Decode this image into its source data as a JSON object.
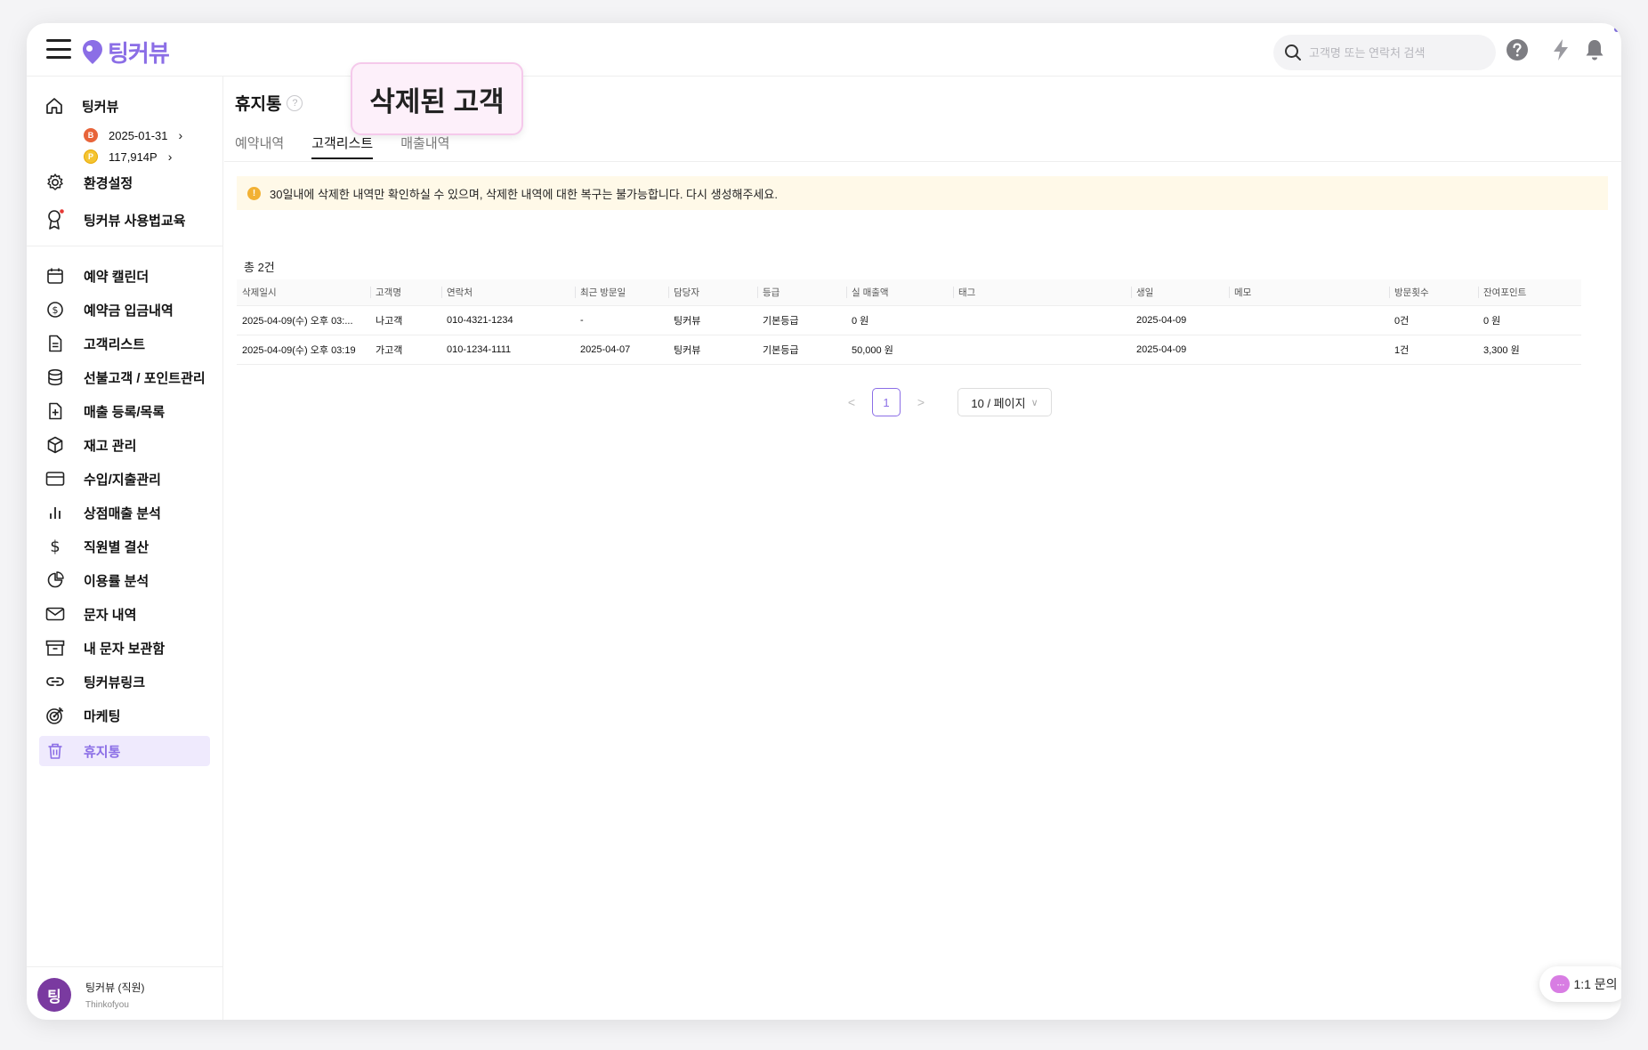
{
  "app": {
    "logo_text": "팅커뷰",
    "search_placeholder": "고객명 또는 연락처 검색"
  },
  "sidebar": {
    "home_title": "팅커뷰",
    "expire_date": "2025-01-31",
    "points": "117,914P",
    "settings": "환경설정",
    "education": "팅커뷰 사용법교육",
    "items": [
      {
        "label": "예약 캘린더"
      },
      {
        "label": "예약금 입금내역"
      },
      {
        "label": "고객리스트"
      },
      {
        "label": "선불고객 / 포인트관리"
      },
      {
        "label": "매출 등록/목록"
      },
      {
        "label": "재고 관리"
      },
      {
        "label": "수입/지출관리"
      },
      {
        "label": "상점매출 분석"
      },
      {
        "label": "직원별 결산"
      },
      {
        "label": "이용률 분석"
      },
      {
        "label": "문자 내역"
      },
      {
        "label": "내 문자 보관함"
      },
      {
        "label": "팅커뷰링크"
      },
      {
        "label": "마케팅"
      },
      {
        "label": "휴지통"
      }
    ],
    "user": {
      "avatar": "팅",
      "name": "팅커뷰 (직원)",
      "sub": "Thinkofyou"
    }
  },
  "main": {
    "title": "휴지통",
    "help": "?",
    "bubble": "삭제된 고객",
    "tabs": [
      {
        "label": "예약내역"
      },
      {
        "label": "고객리스트"
      },
      {
        "label": "매출내역"
      }
    ],
    "alert_icon": "!",
    "alert": "30일내에 삭제한 내역만 확인하실 수 있으며, 삭제한 내역에 대한 복구는 불가능합니다. 다시 생성해주세요.",
    "total": "총 2건",
    "table": {
      "headers": [
        "삭제일시",
        "고객명",
        "연락처",
        "최근 방문일",
        "담당자",
        "등급",
        "실 매출액",
        "태그",
        "생일",
        "메모",
        "방문횟수",
        "잔여포인트"
      ],
      "rows": [
        [
          "2025-04-09(수) 오후 03:...",
          "나고객",
          "010-4321-1234",
          "-",
          "팅커뷰",
          "기본등급",
          "0 원",
          "",
          "2025-04-09",
          "",
          "0건",
          "0 원"
        ],
        [
          "2025-04-09(수) 오후 03:19",
          "가고객",
          "010-1234-1111",
          "2025-04-07",
          "팅커뷰",
          "기본등급",
          "50,000 원",
          "",
          "2025-04-09",
          "",
          "1건",
          "3,300 원"
        ]
      ]
    },
    "pager": {
      "prev": "<",
      "page": "1",
      "next": ">",
      "size": "10 / 페이지",
      "size_chevron": "∨"
    }
  },
  "inquiry": {
    "icon": "···",
    "label": "1:1 문의"
  },
  "colors": {
    "brand": "#8b6ee6",
    "alert_bg": "#fff9e8",
    "avatar": "#7a3aa0",
    "bubble_bg": "#fdf0fa"
  }
}
